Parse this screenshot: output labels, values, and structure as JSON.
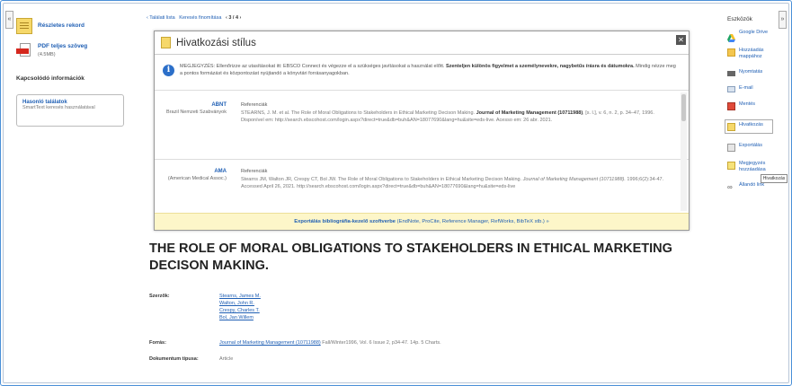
{
  "left": {
    "detailed_record": "Részletes rekord",
    "pdf_full_text": "PDF teljes szöveg",
    "pdf_size": "(4.5MB)",
    "related_info": "Kapcsolódó információk",
    "similar_results": {
      "title": "Hasonló találatok",
      "desc": "SmartText keresés használatával"
    }
  },
  "breadcrumb": {
    "result_list": "‹ Találati lista",
    "refine": "Keresés finomítása",
    "position": "‹ 3 / 4 ›"
  },
  "modal": {
    "title": "Hivatkozási stílus",
    "close": "✕",
    "note_label": "MEGJEGYZÉS:",
    "note_text": "Ellenőrizze az utasításokat itt: EBSCO Connect és végezze el a szükséges javításokat a használat előtt.",
    "note_bold": "Szenteljen különös figyelmet a személynevekre, nagybetűs írásra és dátumokra.",
    "note_tail": "Mindig nézze meg a pontos formázást és központozást nyújtandó a könyvtári forrásanyagokban.",
    "citations": [
      {
        "name": "ABNT",
        "desc": "Brazil Nemzeti Szabványok",
        "label": "Referenciák",
        "text_pre": "STEARNS, J. M. et al. The Role of Moral Obligations to Stakeholders in Ethical Marketing Decison Making.",
        "journal": "Journal of Marketing Management (10711988)",
        "text_post": ", [s. l.], v. 6, n. 2, p. 34–47, 1996. Disponível em: http://search.ebscohost.com/login.aspx?direct=true&db=buh&AN=18077690&lang=hu&site=eds-live. Acesso em: 26 abr. 2021."
      },
      {
        "name": "AMA",
        "desc": "(American Medical Assoc.)",
        "label": "Referenciák",
        "text_pre": "Stearns JM, Walton JR, Crespy CT, Bol JW. The Role of Moral Obligations to Stakeholders in Ethical Marketing Decison Making.",
        "journal": "Journal of Marketing Management (10711988).",
        "text_post": "1996;6(2):34-47. Accessed April 26, 2021. http://search.ebscohost.com/login.aspx?direct=true&db=buh&AN=18077690&lang=hu&site=eds-live"
      }
    ],
    "export_bold": "Exportálás bibliográfia-kezelő szoftverbe",
    "export_tail": "(EndNote, ProCite, Reference Manager, RefWorks, BibTeX stb.) »"
  },
  "article": {
    "title": "THE ROLE OF MORAL OBLIGATIONS TO STAKEHOLDERS IN ETHICAL MARKETING DECISON MAKING.",
    "authors_label": "Szerzők:",
    "authors": [
      "Stearns, James M.",
      "Walton, John R.",
      "Crespy, Charles T.",
      "Bol, Jan Willem"
    ],
    "source_label": "Forrás:",
    "source_journal": "Journal of Marketing Management (10711988)",
    "source_details": "Fall/Winter1996, Vol. 6 Issue 2, p34-47. 14p. 5 Charts.",
    "doctype_label": "Dokumentum típusa:",
    "doctype": "Article"
  },
  "tools": {
    "header": "Eszközök",
    "items": [
      "Google Drive",
      "Hozzáadás mappához",
      "Nyomtatás",
      "E-mail",
      "Mentés",
      "Hivatkozás",
      "Exportálás",
      "Megjegyzés hozzáadása",
      "Állandó link"
    ],
    "tooltip": "Hivatkozás"
  }
}
